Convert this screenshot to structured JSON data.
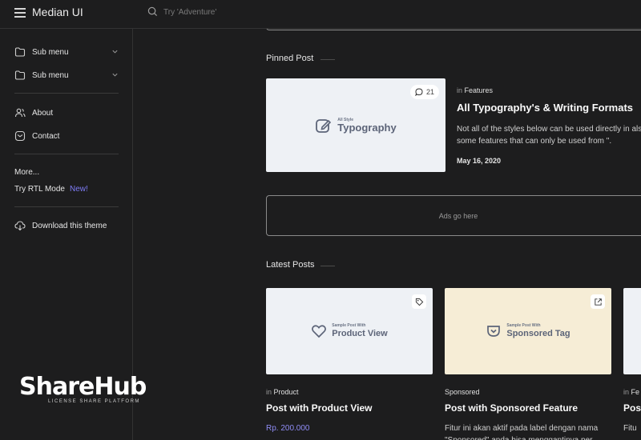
{
  "header": {
    "brand": "Median UI",
    "search_placeholder": "Try 'Adventure'"
  },
  "sidebar": {
    "items": [
      {
        "label": "Sub menu",
        "icon": "folder-icon"
      },
      {
        "label": "Sub menu",
        "icon": "folder-icon"
      },
      {
        "label": "About",
        "icon": "users-icon"
      },
      {
        "label": "Contact",
        "icon": "mail-icon"
      }
    ],
    "more": "More...",
    "rtl_label": "Try RTL Mode",
    "rtl_badge": "New!",
    "download": "Download this theme",
    "logo_text": "ShareHub",
    "logo_sub": "LICENSE SHARE PLATFORM"
  },
  "pinned": {
    "section_title": "Pinned Post",
    "comment_count": "21",
    "thumb_small": "All Style",
    "thumb_big": "Typography",
    "category_prefix": "in",
    "category": "Features",
    "title": "All Typography's & Writing Formats",
    "excerpt": "Not all of the styles below can be used directly in also some features that can only be used from \".",
    "date": "May 16, 2020"
  },
  "ads": {
    "text": "Ads go here"
  },
  "latest": {
    "section_title": "Latest Posts",
    "posts": [
      {
        "thumb_small": "Sample Post With",
        "thumb_big": "Product View",
        "category_prefix": "in",
        "category": "Product",
        "title": "Post with Product View",
        "price": "Rp. 200.000",
        "excerpt": ""
      },
      {
        "thumb_small": "Sample Post With",
        "thumb_big": "Sponsored Tag",
        "category_prefix": "",
        "category": "Sponsored",
        "title": "Post with Sponsored Feature",
        "price": "",
        "excerpt": "Fitur ini akan aktif pada label dengan nama \"Sponsored\" anda bisa menggantinya per"
      },
      {
        "category_prefix": "in",
        "category": "Fe",
        "title": "Post",
        "excerpt": "Fitu"
      }
    ]
  },
  "colors": {
    "background": "#1d1d1e",
    "accent": "#8f8cf5",
    "thumb_light": "#eef1f5",
    "thumb_cream": "#f6edd6"
  }
}
